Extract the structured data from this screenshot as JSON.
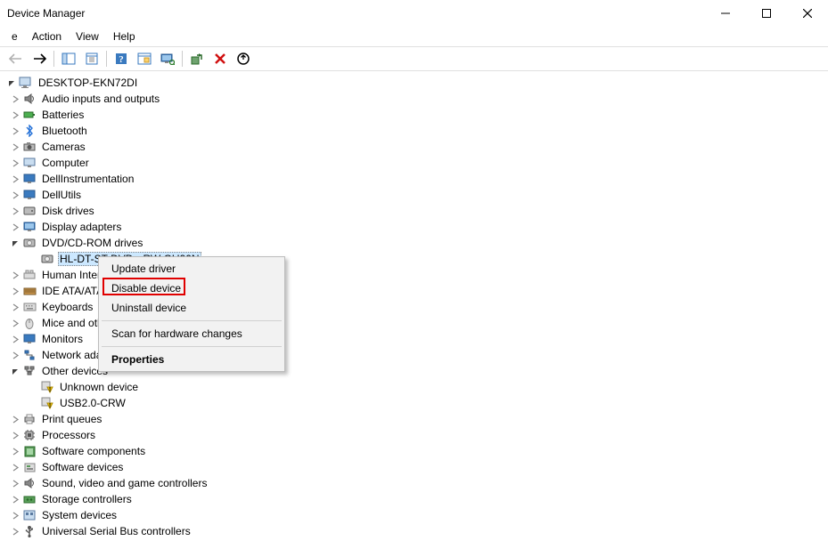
{
  "window": {
    "title": "Device Manager"
  },
  "menubar": {
    "file": "e",
    "action": "Action",
    "view": "View",
    "help": "Help"
  },
  "tree": {
    "root": "DESKTOP-EKN72DI",
    "c0": "Audio inputs and outputs",
    "c1": "Batteries",
    "c2": "Bluetooth",
    "c3": "Cameras",
    "c4": "Computer",
    "c5": "DellInstrumentation",
    "c6": "DellUtils",
    "c7": "Disk drives",
    "c8": "Display adapters",
    "c9": "DVD/CD-ROM drives",
    "c9a": "HL-DT-ST DVD+-RW GU90N",
    "c10": "Human Interface Devices",
    "c11": "IDE ATA/ATAPI controllers",
    "c12": "Keyboards",
    "c13": "Mice and other pointing devices",
    "c14": "Monitors",
    "c15": "Network adapters",
    "c16": "Other devices",
    "c16a": "Unknown device",
    "c16b": "USB2.0-CRW",
    "c17": "Print queues",
    "c18": "Processors",
    "c19": "Software components",
    "c20": "Software devices",
    "c21": "Sound, video and game controllers",
    "c22": "Storage controllers",
    "c23": "System devices",
    "c24": "Universal Serial Bus controllers"
  },
  "contextmenu": {
    "update": "Update driver",
    "disable": "Disable device",
    "uninstall": "Uninstall device",
    "scan": "Scan for hardware changes",
    "properties": "Properties"
  }
}
